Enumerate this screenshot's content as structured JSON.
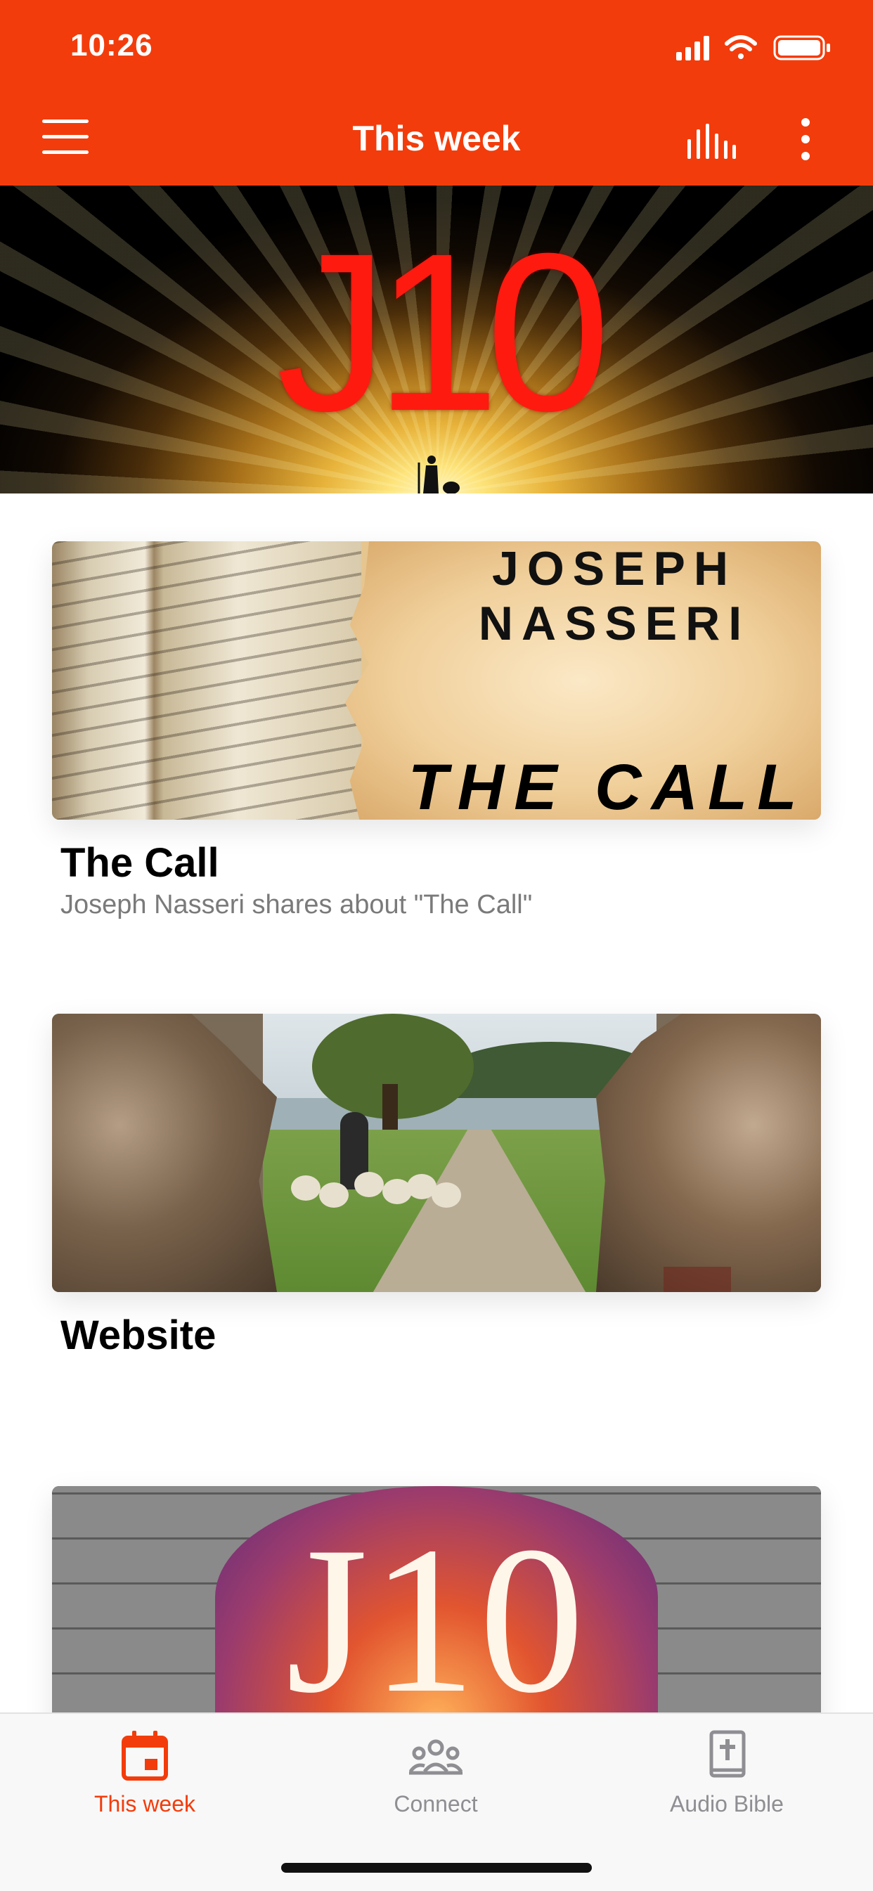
{
  "status_bar": {
    "time": "10:26"
  },
  "nav": {
    "title": "This week",
    "menu_icon": "hamburger-menu-icon",
    "action_icons": [
      "equalizer-icon",
      "more-vertical-icon"
    ]
  },
  "hero": {
    "logo_text": "J10"
  },
  "cards": [
    {
      "title": "The Call",
      "subtitle": "Joseph Nasseri shares about \"The Call\"",
      "image_text": {
        "name": "JOSEPH NASSERI",
        "title": "THE CALL"
      }
    },
    {
      "title": "Website",
      "subtitle": ""
    },
    {
      "title": "",
      "image_text": {
        "logo": "J10"
      }
    }
  ],
  "tabbar": {
    "tabs": [
      {
        "label": "This week",
        "icon": "calendar-icon",
        "active": true
      },
      {
        "label": "Connect",
        "icon": "people-icon",
        "active": false
      },
      {
        "label": "Audio Bible",
        "icon": "bible-icon",
        "active": false
      }
    ],
    "active_color": "#f33c0b",
    "inactive_color": "#8e8e93"
  },
  "colors": {
    "brand": "#f33c0b"
  }
}
